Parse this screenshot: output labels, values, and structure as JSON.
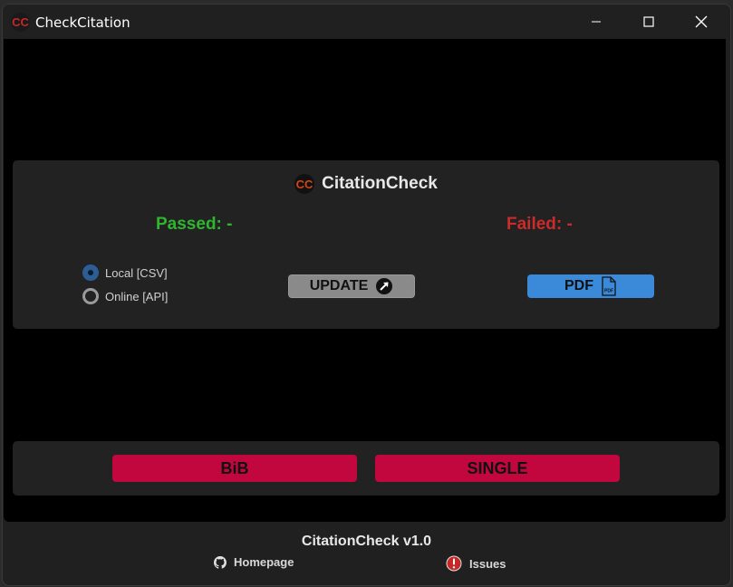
{
  "window": {
    "title": "CheckCitation",
    "logo_text": "CC"
  },
  "header": {
    "title": "CitationCheck"
  },
  "stats": {
    "passed_label": "Passed: -",
    "failed_label": "Failed: -"
  },
  "source": {
    "options": [
      {
        "label": "Local [CSV]",
        "checked": true
      },
      {
        "label": "Online [API]",
        "checked": false
      }
    ]
  },
  "buttons": {
    "update_label": "UPDATE",
    "pdf_label": "PDF",
    "pdf_icon_text": "PDF",
    "bib_label": "BiB",
    "single_label": "SINGLE"
  },
  "footer": {
    "version": "CitationCheck v1.0",
    "homepage_label": "Homepage",
    "issues_label": "Issues"
  },
  "colors": {
    "passed": "#2fb52f",
    "failed": "#cc2b2b",
    "pdf_button": "#3b8ad9",
    "update_button": "#8a8a8a",
    "action_button": "#c2073f",
    "radio_selected": "#2d5d95",
    "logo": "#c62828"
  },
  "icons": {
    "app": "cc-logo-icon",
    "update": "arrow-up-right-circle-icon",
    "pdf": "pdf-file-icon",
    "homepage": "github-icon",
    "issues": "exclamation-circle-icon"
  }
}
